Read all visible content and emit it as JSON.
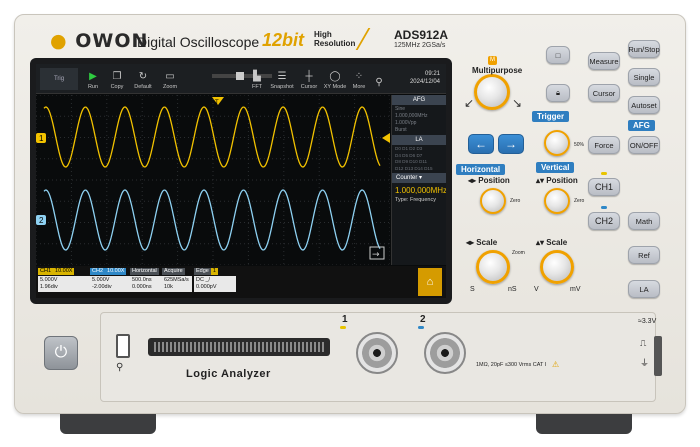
{
  "header": {
    "logo": "OWON",
    "title": "Digital Oscilloscope",
    "bit_label": "12bit",
    "hires_line1": "High",
    "hires_line2": "Resolution",
    "model": "ADS912A",
    "model_sub": "125MHz  2GSa/s"
  },
  "toolbar": {
    "trig_label": "Trig",
    "items": [
      {
        "label": "Run",
        "icon": "▶"
      },
      {
        "label": "Copy",
        "icon": "❐"
      },
      {
        "label": "Default",
        "icon": "↻"
      },
      {
        "label": "Zoom",
        "icon": "▭"
      },
      {
        "label": "FFT",
        "icon": "▙"
      },
      {
        "label": "Snapshot",
        "icon": "☰"
      },
      {
        "label": "Cursor",
        "icon": "┼"
      },
      {
        "label": "XY Mode",
        "icon": "◯"
      },
      {
        "label": "More",
        "icon": "⁘"
      }
    ],
    "time": "09:21",
    "date": "2024/12/04"
  },
  "side_panel": {
    "afg_title": "AFG",
    "afg_lines": [
      "Sine",
      "1.000,000MHz",
      "1.000Vpp",
      "Burst"
    ],
    "la_title": "LA",
    "la_rows": [
      "D0  D1  D2  D3",
      "D4  D5  D6  D7",
      "D8  D9 D10 D11",
      "D12 D13 D14 D15"
    ],
    "counter_title": "Counter",
    "counter_value": "1.000,000MHz",
    "counter_type": "Type: Frequency"
  },
  "status": {
    "ch1_head": "CH1",
    "ch1_probe": "10.00X",
    "ch1_scale": "5.000V",
    "ch1_offset": "1.96div",
    "ch2_head": "CH2",
    "ch2_probe": "10.00X",
    "ch2_scale": "5.000V",
    "ch2_offset": "-2.00div",
    "horiz_head": "Horizontal",
    "horiz_scale": "500.0ns",
    "horiz_pos": "0.000ns",
    "acq_head": "Acquire",
    "acq_rate": "625MSa/s",
    "acq_depth": "10k",
    "edge_head": "Edge",
    "edge_src": "1",
    "edge_mode": "DC  _/",
    "edge_level": "0.000pV"
  },
  "panel": {
    "multipurpose": "Multipurpose",
    "m_badge": "M",
    "measure": "Measure",
    "cursor": "Cursor",
    "run_stop": "Run/Stop",
    "single": "Single",
    "autoset": "Autoset",
    "trigger": "Trigger",
    "force": "Force",
    "afg": "AFG",
    "on_off": "ON/OFF",
    "horizontal": "Horizontal",
    "vertical": "Vertical",
    "position": "Position",
    "scale": "Scale",
    "zero": "Zero",
    "pct50": "50%",
    "ch1": "CH1",
    "ch2": "CH2",
    "math": "Math",
    "ref": "Ref",
    "la": "LA",
    "s": "S",
    "ns": "nS",
    "v": "V",
    "mv": "mV"
  },
  "front": {
    "logic_analyzer": "Logic Analyzer",
    "ch1_num": "1",
    "ch2_num": "2",
    "spec": "1MΩ, 20pF  ≤300 Vrms CAT I",
    "side_33v": "≈3.3V"
  },
  "colors": {
    "ch1": "#f2c200",
    "ch2": "#8ed1f2",
    "accent": "#2f7ec0",
    "knob_ring": "#f0a100"
  }
}
